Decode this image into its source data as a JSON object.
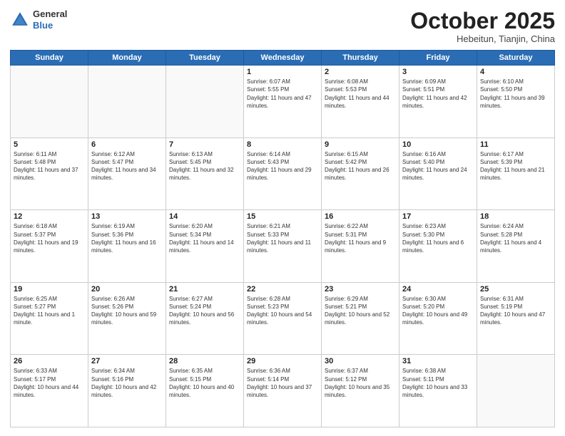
{
  "header": {
    "logo_general": "General",
    "logo_blue": "Blue",
    "month_title": "October 2025",
    "location": "Hebeitun, Tianjin, China"
  },
  "weekdays": [
    "Sunday",
    "Monday",
    "Tuesday",
    "Wednesday",
    "Thursday",
    "Friday",
    "Saturday"
  ],
  "weeks": [
    [
      {
        "day": "",
        "info": ""
      },
      {
        "day": "",
        "info": ""
      },
      {
        "day": "",
        "info": ""
      },
      {
        "day": "1",
        "info": "Sunrise: 6:07 AM\nSunset: 5:55 PM\nDaylight: 11 hours and 47 minutes."
      },
      {
        "day": "2",
        "info": "Sunrise: 6:08 AM\nSunset: 5:53 PM\nDaylight: 11 hours and 44 minutes."
      },
      {
        "day": "3",
        "info": "Sunrise: 6:09 AM\nSunset: 5:51 PM\nDaylight: 11 hours and 42 minutes."
      },
      {
        "day": "4",
        "info": "Sunrise: 6:10 AM\nSunset: 5:50 PM\nDaylight: 11 hours and 39 minutes."
      }
    ],
    [
      {
        "day": "5",
        "info": "Sunrise: 6:11 AM\nSunset: 5:48 PM\nDaylight: 11 hours and 37 minutes."
      },
      {
        "day": "6",
        "info": "Sunrise: 6:12 AM\nSunset: 5:47 PM\nDaylight: 11 hours and 34 minutes."
      },
      {
        "day": "7",
        "info": "Sunrise: 6:13 AM\nSunset: 5:45 PM\nDaylight: 11 hours and 32 minutes."
      },
      {
        "day": "8",
        "info": "Sunrise: 6:14 AM\nSunset: 5:43 PM\nDaylight: 11 hours and 29 minutes."
      },
      {
        "day": "9",
        "info": "Sunrise: 6:15 AM\nSunset: 5:42 PM\nDaylight: 11 hours and 26 minutes."
      },
      {
        "day": "10",
        "info": "Sunrise: 6:16 AM\nSunset: 5:40 PM\nDaylight: 11 hours and 24 minutes."
      },
      {
        "day": "11",
        "info": "Sunrise: 6:17 AM\nSunset: 5:39 PM\nDaylight: 11 hours and 21 minutes."
      }
    ],
    [
      {
        "day": "12",
        "info": "Sunrise: 6:18 AM\nSunset: 5:37 PM\nDaylight: 11 hours and 19 minutes."
      },
      {
        "day": "13",
        "info": "Sunrise: 6:19 AM\nSunset: 5:36 PM\nDaylight: 11 hours and 16 minutes."
      },
      {
        "day": "14",
        "info": "Sunrise: 6:20 AM\nSunset: 5:34 PM\nDaylight: 11 hours and 14 minutes."
      },
      {
        "day": "15",
        "info": "Sunrise: 6:21 AM\nSunset: 5:33 PM\nDaylight: 11 hours and 11 minutes."
      },
      {
        "day": "16",
        "info": "Sunrise: 6:22 AM\nSunset: 5:31 PM\nDaylight: 11 hours and 9 minutes."
      },
      {
        "day": "17",
        "info": "Sunrise: 6:23 AM\nSunset: 5:30 PM\nDaylight: 11 hours and 6 minutes."
      },
      {
        "day": "18",
        "info": "Sunrise: 6:24 AM\nSunset: 5:28 PM\nDaylight: 11 hours and 4 minutes."
      }
    ],
    [
      {
        "day": "19",
        "info": "Sunrise: 6:25 AM\nSunset: 5:27 PM\nDaylight: 11 hours and 1 minute."
      },
      {
        "day": "20",
        "info": "Sunrise: 6:26 AM\nSunset: 5:26 PM\nDaylight: 10 hours and 59 minutes."
      },
      {
        "day": "21",
        "info": "Sunrise: 6:27 AM\nSunset: 5:24 PM\nDaylight: 10 hours and 56 minutes."
      },
      {
        "day": "22",
        "info": "Sunrise: 6:28 AM\nSunset: 5:23 PM\nDaylight: 10 hours and 54 minutes."
      },
      {
        "day": "23",
        "info": "Sunrise: 6:29 AM\nSunset: 5:21 PM\nDaylight: 10 hours and 52 minutes."
      },
      {
        "day": "24",
        "info": "Sunrise: 6:30 AM\nSunset: 5:20 PM\nDaylight: 10 hours and 49 minutes."
      },
      {
        "day": "25",
        "info": "Sunrise: 6:31 AM\nSunset: 5:19 PM\nDaylight: 10 hours and 47 minutes."
      }
    ],
    [
      {
        "day": "26",
        "info": "Sunrise: 6:33 AM\nSunset: 5:17 PM\nDaylight: 10 hours and 44 minutes."
      },
      {
        "day": "27",
        "info": "Sunrise: 6:34 AM\nSunset: 5:16 PM\nDaylight: 10 hours and 42 minutes."
      },
      {
        "day": "28",
        "info": "Sunrise: 6:35 AM\nSunset: 5:15 PM\nDaylight: 10 hours and 40 minutes."
      },
      {
        "day": "29",
        "info": "Sunrise: 6:36 AM\nSunset: 5:14 PM\nDaylight: 10 hours and 37 minutes."
      },
      {
        "day": "30",
        "info": "Sunrise: 6:37 AM\nSunset: 5:12 PM\nDaylight: 10 hours and 35 minutes."
      },
      {
        "day": "31",
        "info": "Sunrise: 6:38 AM\nSunset: 5:11 PM\nDaylight: 10 hours and 33 minutes."
      },
      {
        "day": "",
        "info": ""
      }
    ]
  ]
}
